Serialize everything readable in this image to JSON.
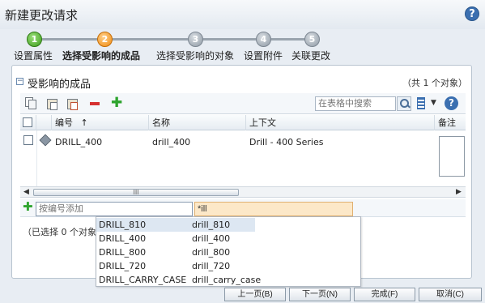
{
  "window": {
    "title": "新建更改请求",
    "help_label": "?"
  },
  "wizard": {
    "steps": [
      {
        "num": "1",
        "label": "设置属性",
        "state": "done"
      },
      {
        "num": "2",
        "label": "选择受影响的成品",
        "state": "current"
      },
      {
        "num": "3",
        "label": "选择受影响的对象",
        "state": "todo"
      },
      {
        "num": "4",
        "label": "设置附件",
        "state": "todo"
      },
      {
        "num": "5",
        "label": "关联更改",
        "state": "todo"
      }
    ]
  },
  "panel": {
    "collapse_symbol": "−",
    "title": "受影响的成品",
    "count": "（共 1 个对象）",
    "toolbar": {
      "add_symbol": "✚",
      "search_placeholder": "在表格中搜索",
      "columns_caret": "▼",
      "help_label": "?"
    },
    "table": {
      "headers": {
        "number": "编号",
        "sort_indicator": "↑",
        "name": "名称",
        "context": "上下文",
        "notes": "备注"
      },
      "rows": [
        {
          "number": "DRILL_400",
          "name": "drill_400",
          "context": "Drill - 400 Series",
          "notes": ""
        }
      ]
    },
    "scrollbar": {
      "left_arrow": "◀",
      "right_arrow": "▶",
      "thumb_grip": "III"
    },
    "add_row": {
      "add_symbol": "✚",
      "number_placeholder": "按编号添加",
      "name_value": "*ill"
    },
    "status": "（已选择 0 个对象"
  },
  "autocomplete": {
    "items": [
      {
        "number": "DRILL_810",
        "name": "drill_810",
        "selected": true
      },
      {
        "number": "DRILL_400",
        "name": "drill_400",
        "selected": false
      },
      {
        "number": "DRILL_800",
        "name": "drill_800",
        "selected": false
      },
      {
        "number": "DRILL_720",
        "name": "drill_720",
        "selected": false
      },
      {
        "number": "DRILL_CARRY_CASE",
        "name": "drill_carry_case",
        "selected": false
      }
    ]
  },
  "footer": {
    "prev_label": "上一页(B)",
    "next_label": "下一页(N)",
    "finish_label": "完成(F)",
    "cancel_label": "取消(C)"
  },
  "colors": {
    "step_done": "#3c9a1c",
    "step_current": "#f08a10",
    "step_todo": "#8f9aa5",
    "delete": "#d63030",
    "add": "#2ea42e",
    "highlight_input": "#fce8c8",
    "selected_row": "#dde7f2"
  }
}
